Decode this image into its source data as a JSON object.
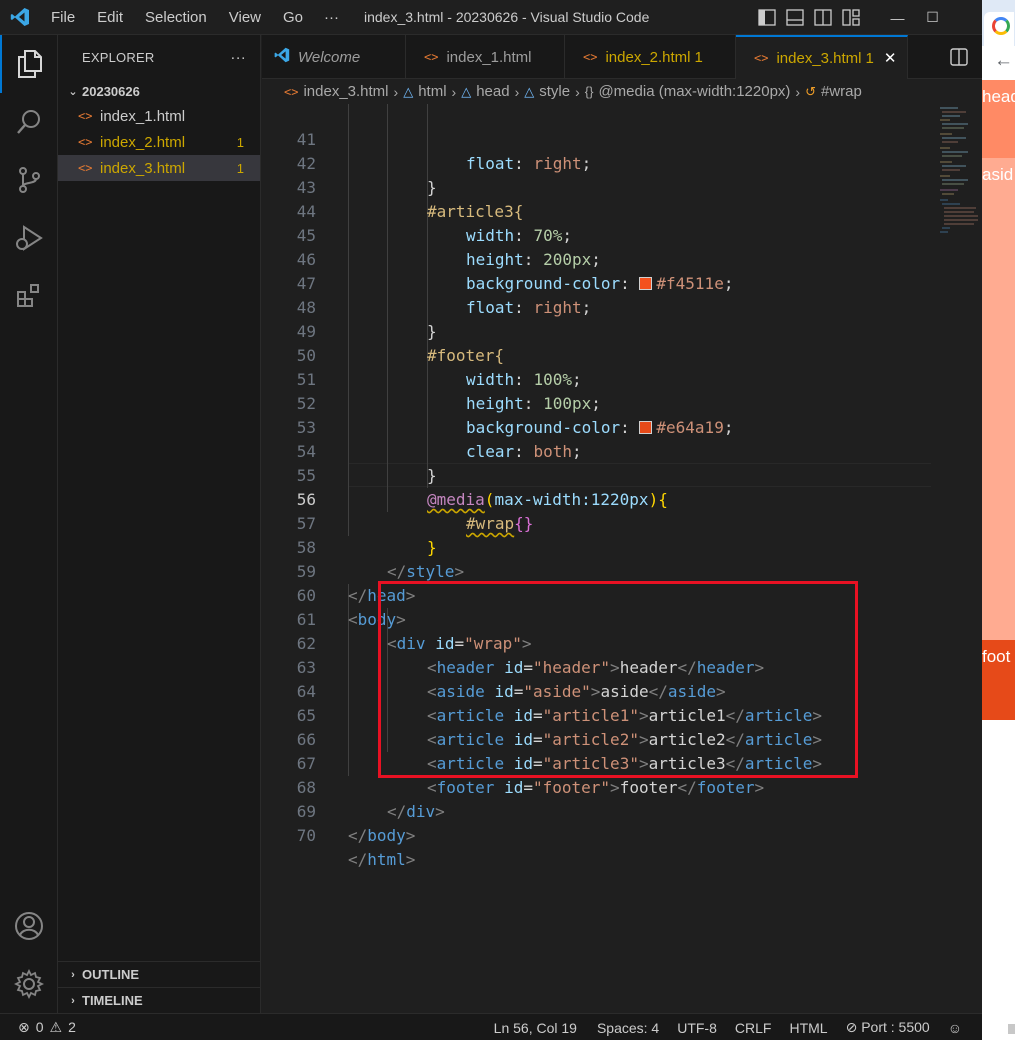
{
  "titlebar": {
    "menu": [
      "File",
      "Edit",
      "Selection",
      "View",
      "Go"
    ],
    "more": "···",
    "title": "index_3.html - 20230626 - Visual Studio Code",
    "controls": {
      "minimize": "—",
      "maximize": "☐"
    }
  },
  "sidebar": {
    "header": "EXPLORER",
    "more": "···",
    "folder": "20230626",
    "files": [
      {
        "icon": "<>",
        "name": "index_1.html",
        "badge": ""
      },
      {
        "icon": "<>",
        "name": "index_2.html",
        "badge": "1"
      },
      {
        "icon": "<>",
        "name": "index_3.html",
        "badge": "1"
      }
    ],
    "outline": "OUTLINE",
    "timeline": "TIMELINE"
  },
  "tabs": [
    {
      "label": "Welcome"
    },
    {
      "icon": "<>",
      "label": "index_1.html",
      "badge": ""
    },
    {
      "icon": "<>",
      "label": "index_2.html",
      "badge": "1"
    },
    {
      "icon": "<>",
      "label": "index_3.html",
      "badge": "1",
      "close": "✕"
    }
  ],
  "breadcrumb": {
    "file": "index_3.html",
    "items": [
      "html",
      "head",
      "style",
      "@media (max-width:1220px)",
      "#wrap"
    ],
    "file_icon": "<>",
    "braces": "{}"
  },
  "editor": {
    "line_numbers": [
      "41",
      "42",
      "43",
      "44",
      "45",
      "46",
      "47",
      "48",
      "49",
      "50",
      "51",
      "52",
      "53",
      "54",
      "55",
      "56",
      "57",
      "58",
      "59",
      "60",
      "61",
      "62",
      "63",
      "64",
      "65",
      "66",
      "67",
      "68",
      "69",
      "70"
    ],
    "current_line": "56",
    "colors": {
      "swatch1": "#f4511e",
      "swatch2": "#e64a19",
      "highlight_box": "#e81123"
    },
    "code": {
      "l41": {
        "prop": "float",
        "val": "right"
      },
      "l42": "}",
      "l43": "#article3{",
      "l44": {
        "prop": "width",
        "val": "70%"
      },
      "l45": {
        "prop": "height",
        "val": "200px"
      },
      "l46": {
        "prop": "background-color",
        "val": "#f4511e"
      },
      "l47": {
        "prop": "float",
        "val": "right"
      },
      "l48": "}",
      "l49": "#footer{",
      "l50": {
        "prop": "width",
        "val": "100%"
      },
      "l51": {
        "prop": "height",
        "val": "100px"
      },
      "l52": {
        "prop": "background-color",
        "val": "#e64a19"
      },
      "l53": {
        "prop": "clear",
        "val": "both"
      },
      "l54": "}",
      "l55": {
        "at": "@media",
        "cond": "max-width:1220px"
      },
      "l56": "#wrap",
      "l57": "}",
      "l58": "style",
      "l59": "head",
      "l60": "body",
      "l61": {
        "tag": "div",
        "attr": "id",
        "val": "\"wrap\""
      },
      "l62": {
        "tag": "header",
        "attr": "id",
        "val": "\"header\"",
        "text": "header"
      },
      "l63": {
        "tag": "aside",
        "attr": "id",
        "val": "\"aside\"",
        "text": "aside"
      },
      "l64": {
        "tag": "article",
        "attr": "id",
        "val": "\"article1\"",
        "text": "article1"
      },
      "l65": {
        "tag": "article",
        "attr": "id",
        "val": "\"article2\"",
        "text": "article2"
      },
      "l66": {
        "tag": "article",
        "attr": "id",
        "val": "\"article3\"",
        "text": "article3"
      },
      "l67": {
        "tag": "footer",
        "attr": "id",
        "val": "\"footer\"",
        "text": "footer"
      },
      "l68": "div",
      "l69": "body",
      "l70": "html"
    }
  },
  "browser": {
    "header": "head",
    "aside": "asid",
    "footer": "foot",
    "colors": {
      "header_bg": "#ff8a65",
      "aside_bg": "#ffab91",
      "footer_bg": "#e64a19",
      "tab_bg": "#dfe9f6"
    }
  },
  "statusbar": {
    "errors": "0",
    "warnings": "2",
    "position": "Ln 56, Col 19",
    "spaces": "Spaces: 4",
    "encoding": "UTF-8",
    "eol": "CRLF",
    "language": "HTML",
    "port": "Port : 5500"
  }
}
